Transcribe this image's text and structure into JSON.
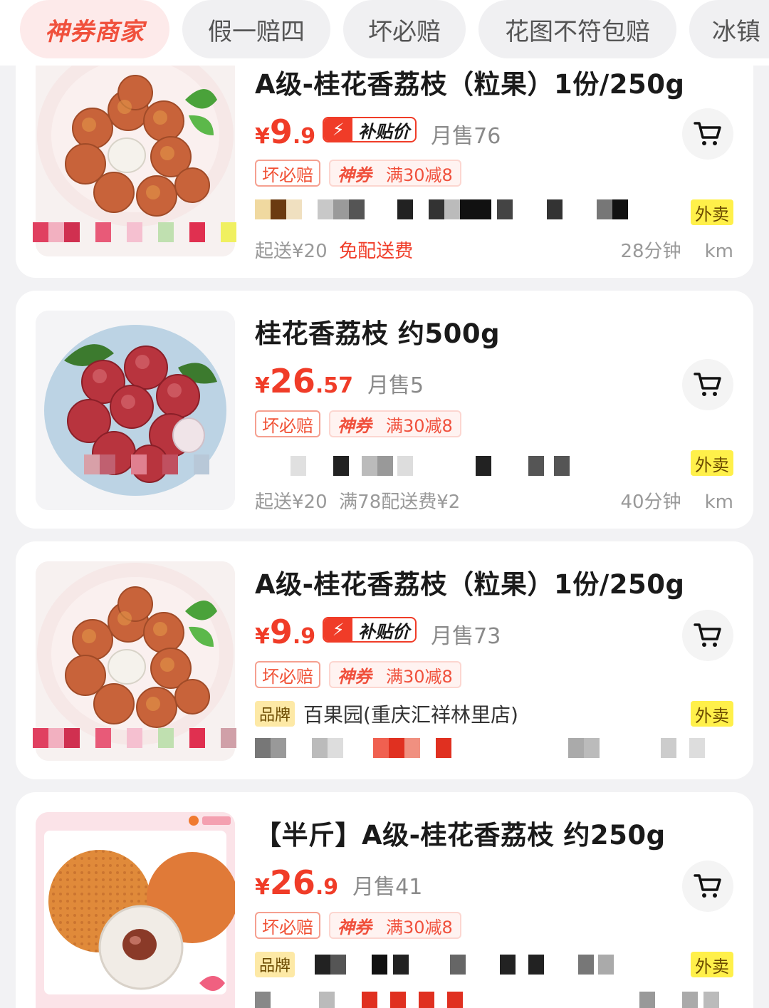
{
  "filters": [
    {
      "label": "神券商家",
      "active": true
    },
    {
      "label": "假一赔四",
      "active": false
    },
    {
      "label": "坏必赔",
      "active": false
    },
    {
      "label": "花图不符包赔",
      "active": false
    },
    {
      "label": "冰镇",
      "active": false
    }
  ],
  "products": [
    {
      "title": "A级-桂花香荔枝（粒果）1份/250g",
      "price_currency": "¥",
      "price_int": "9",
      "price_dec": ".9",
      "flash_label": "补贴价",
      "sold": "月售76",
      "guarantee_tag": "坏必赔",
      "coupon_label": "神券",
      "coupon_text": "满30减8",
      "delivery_tag": "外卖",
      "min_order": "起送¥20",
      "free_delivery": "免配送费",
      "time": "28分钟",
      "distance": "km",
      "image": "lychee-plate-white"
    },
    {
      "title": "桂花香荔枝 约500g",
      "price_currency": "¥",
      "price_int": "26",
      "price_dec": ".57",
      "sold": "月售5",
      "guarantee_tag": "坏必赔",
      "coupon_label": "神券",
      "coupon_text": "满30减8",
      "delivery_tag": "外卖",
      "min_order": "起送¥20",
      "free_delivery": "满78配送费¥2",
      "time": "40分钟",
      "distance": "km",
      "image": "lychee-plate-blue"
    },
    {
      "title": "A级-桂花香荔枝（粒果）1份/250g",
      "price_currency": "¥",
      "price_int": "9",
      "price_dec": ".9",
      "flash_label": "补贴价",
      "sold": "月售73",
      "guarantee_tag": "坏必赔",
      "coupon_label": "神券",
      "coupon_text": "满30减8",
      "brand_tag": "品牌",
      "shop_name": "百果园(重庆汇祥林里店)",
      "delivery_tag": "外卖",
      "image": "lychee-plate-white"
    },
    {
      "title": "【半斤】A级-桂花香荔枝 约250g",
      "price_currency": "¥",
      "price_int": "26",
      "price_dec": ".9",
      "sold": "月售41",
      "guarantee_tag": "坏必赔",
      "coupon_label": "神券",
      "coupon_text": "满30减8",
      "brand_tag": "品牌",
      "delivery_tag": "外卖",
      "image": "lychee-pink-banner"
    }
  ],
  "colors": {
    "accent": "#f03c28",
    "background": "#f2f2f4",
    "delivery_tag": "#fff04a",
    "brand_tag": "#fde9a6"
  },
  "icons": {
    "cart": "shopping-cart-icon",
    "bolt": "lightning-bolt-icon"
  }
}
